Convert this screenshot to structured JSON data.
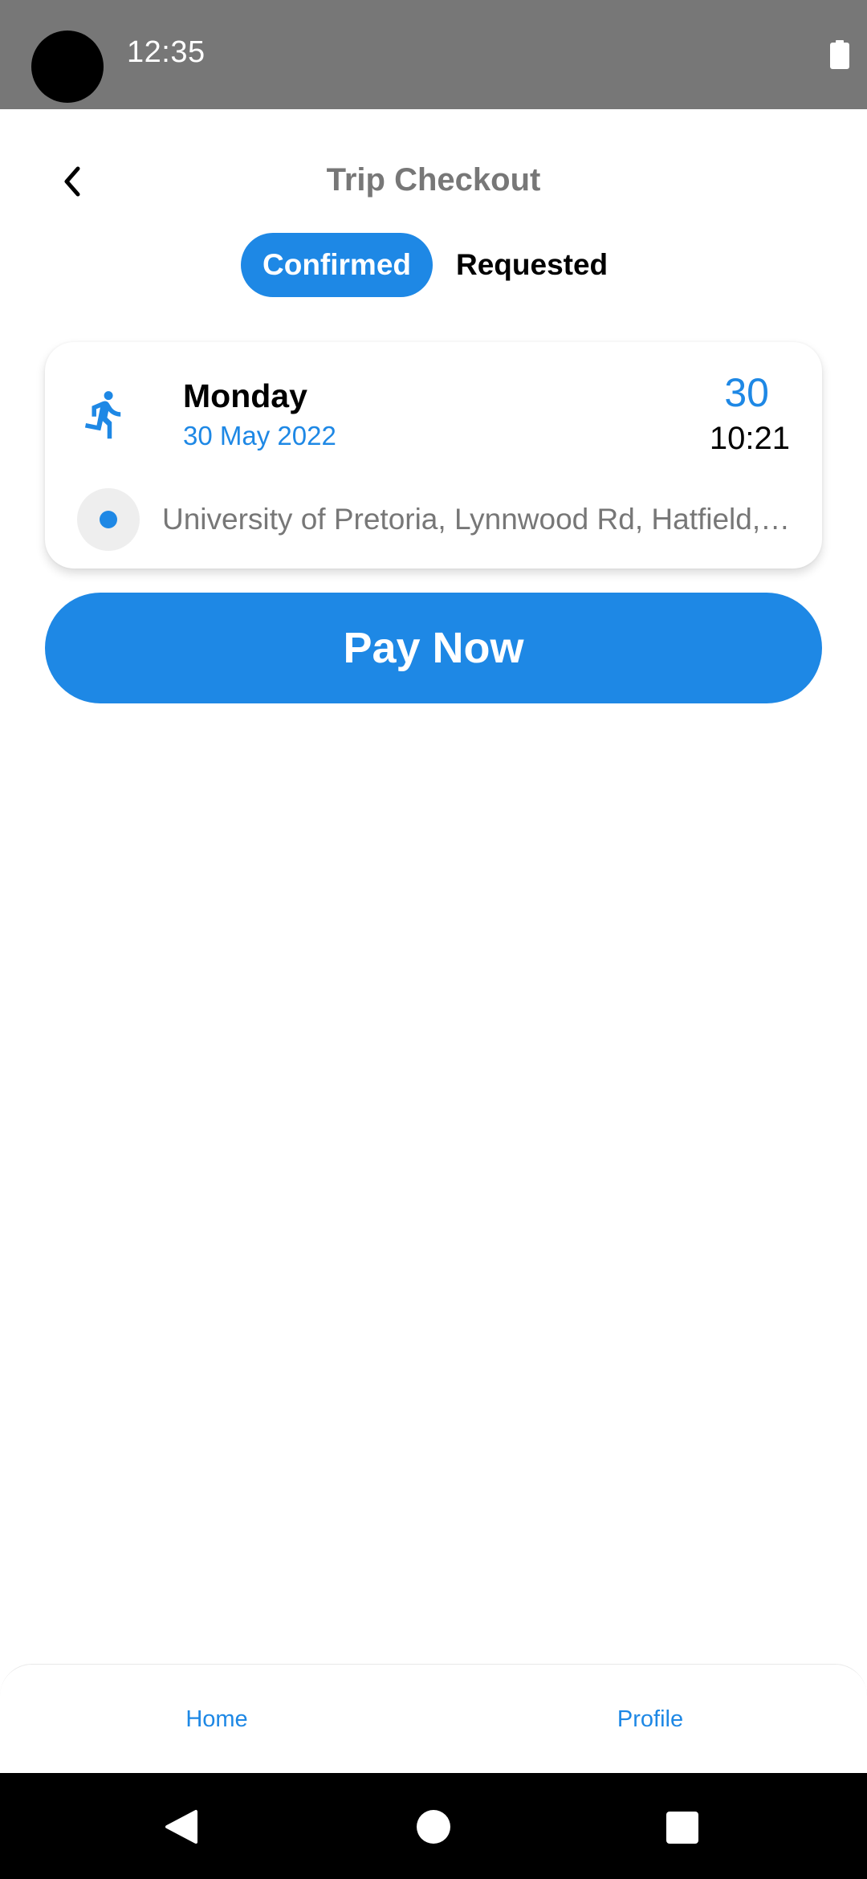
{
  "status_bar": {
    "time": "12:35",
    "icons": [
      "camera-cutout",
      "battery-icon"
    ]
  },
  "header": {
    "back_icon": "chevron-left-icon",
    "title": "Trip Checkout"
  },
  "tabs": [
    {
      "label": "Confirmed",
      "active": true
    },
    {
      "label": "Requested",
      "active": false
    }
  ],
  "trip": {
    "mode_icon": "runner-icon",
    "day": "Monday",
    "date": "30 May 2022",
    "day_number": "30",
    "time": "10:21",
    "location_icon": "location-dot-icon",
    "address": "University of Pretoria, Lynnwood Rd, Hatfield, Pretoria"
  },
  "actions": {
    "pay_label": "Pay Now"
  },
  "bottom_nav": {
    "items": [
      {
        "label": "Home"
      },
      {
        "label": "Profile"
      }
    ]
  },
  "colors": {
    "accent": "#1e88e5",
    "status_bar": "#777777",
    "muted_text": "#777777"
  }
}
